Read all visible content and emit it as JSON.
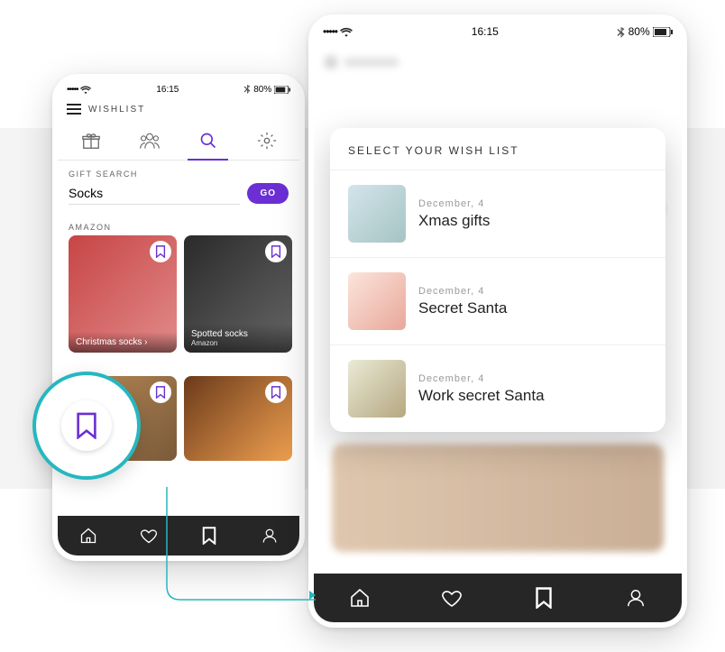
{
  "status": {
    "carrier": "•••••",
    "time": "16:15",
    "battery": "80%"
  },
  "header": {
    "title": "WISHLIST"
  },
  "search": {
    "label": "GIFT SEARCH",
    "value": "Socks",
    "go": "GO"
  },
  "section": {
    "amazon": "AMAZON"
  },
  "cards": [
    {
      "title": "Christmas socks",
      "sub": ""
    },
    {
      "title": "Spotted socks",
      "sub": "Amazon"
    }
  ],
  "modal": {
    "title": "SELECT YOUR WISH LIST",
    "items": [
      {
        "date": "December, 4",
        "name": "Xmas gifts"
      },
      {
        "date": "December, 4",
        "name": "Secret Santa"
      },
      {
        "date": "December, 4",
        "name": "Work secret Santa"
      }
    ]
  }
}
